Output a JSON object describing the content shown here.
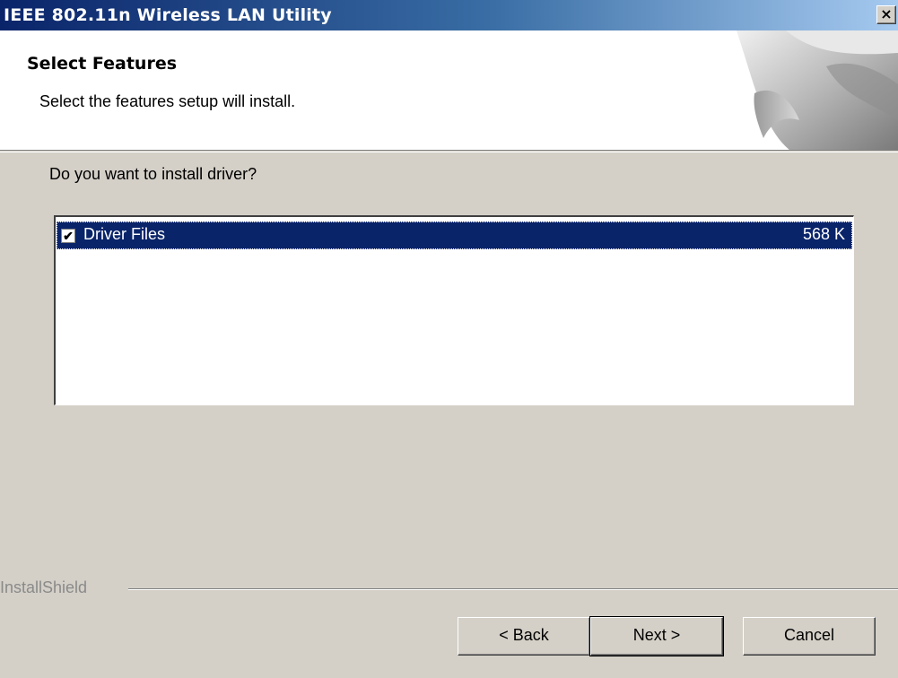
{
  "window": {
    "title": "IEEE 802.11n Wireless LAN Utility",
    "close_glyph": "×"
  },
  "header": {
    "title": "Select Features",
    "subtitle": "Select the features setup will install."
  },
  "main": {
    "question": "Do you want to install driver?",
    "features": [
      {
        "label": "Driver Files",
        "size": "568 K",
        "checked": true,
        "selected": true
      }
    ]
  },
  "footer": {
    "brand": "InstallShield"
  },
  "buttons": {
    "back": "< Back",
    "next": "Next >",
    "cancel": "Cancel"
  },
  "colors": {
    "title_start": "#0a246a",
    "title_end": "#a6caf0",
    "selection": "#0a246a",
    "dialog_face": "#d4d0c8"
  },
  "icons": {
    "checkbox": "checkmark-icon",
    "close": "close-icon",
    "header_art": "page-curl-graphic"
  }
}
